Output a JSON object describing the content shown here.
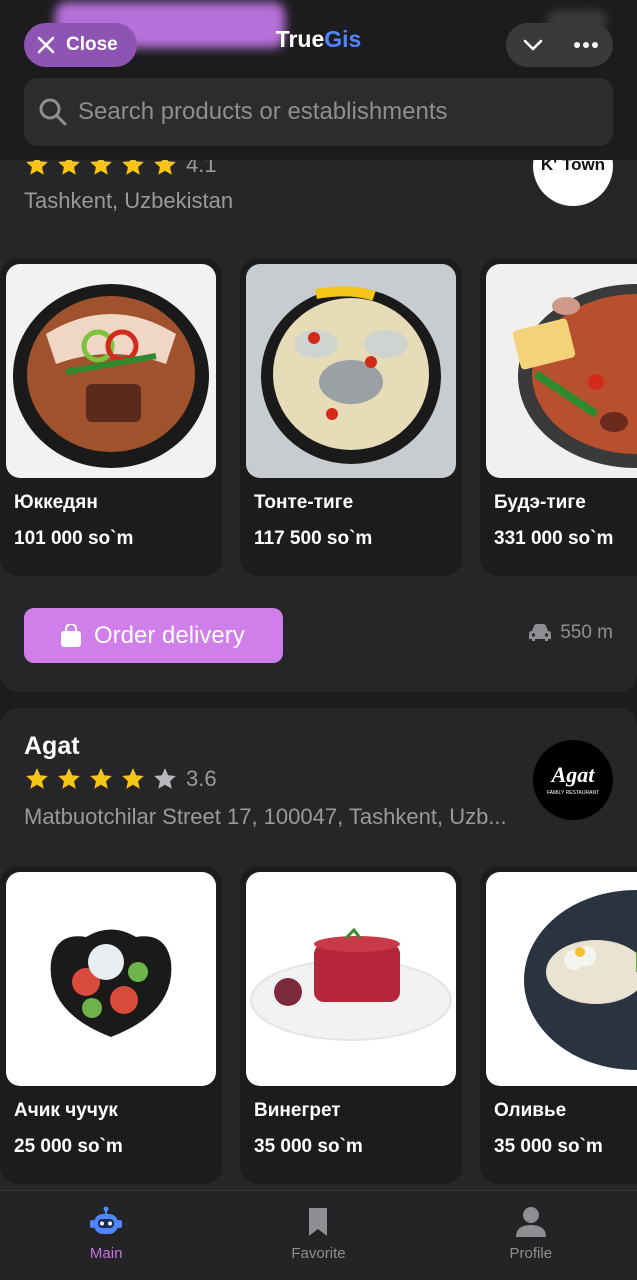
{
  "header": {
    "close_label": "Close",
    "brand_part1": "True",
    "brand_part2": "Gis",
    "search_placeholder": "Search products or establishments"
  },
  "restaurants": [
    {
      "name": "",
      "rating": "4.1",
      "stars_filled": 5,
      "address": "Tashkent, Uzbekistan",
      "logo_text": "K' Town",
      "products": [
        {
          "name": "Юккедян",
          "price": "101 000 so`m"
        },
        {
          "name": "Тонте-тиге",
          "price": "117 500 so`m"
        },
        {
          "name": "Будэ-тиге",
          "price": "331 000 so`m"
        }
      ],
      "order_label": "Order delivery",
      "distance": "550 m"
    },
    {
      "name": "Agat",
      "rating": "3.6",
      "stars_filled": 4,
      "address": "Matbuotchilar Street 17, 100047, Tashkent, Uzb...",
      "logo_text": "Agat",
      "logo_subtext": "FAMILY RESTAURANT",
      "products": [
        {
          "name": "Ачик чучук",
          "price": "25 000 so`m"
        },
        {
          "name": "Винегрет",
          "price": "35 000 so`m"
        },
        {
          "name": "Оливье",
          "price": "35 000 so`m"
        }
      ]
    }
  ],
  "nav": {
    "main": "Main",
    "favorite": "Favorite",
    "profile": "Profile"
  },
  "colors": {
    "accent": "#d07ee9",
    "brand_blue": "#4f86ff",
    "star": "#f5c518",
    "background": "#1c1c1e"
  }
}
